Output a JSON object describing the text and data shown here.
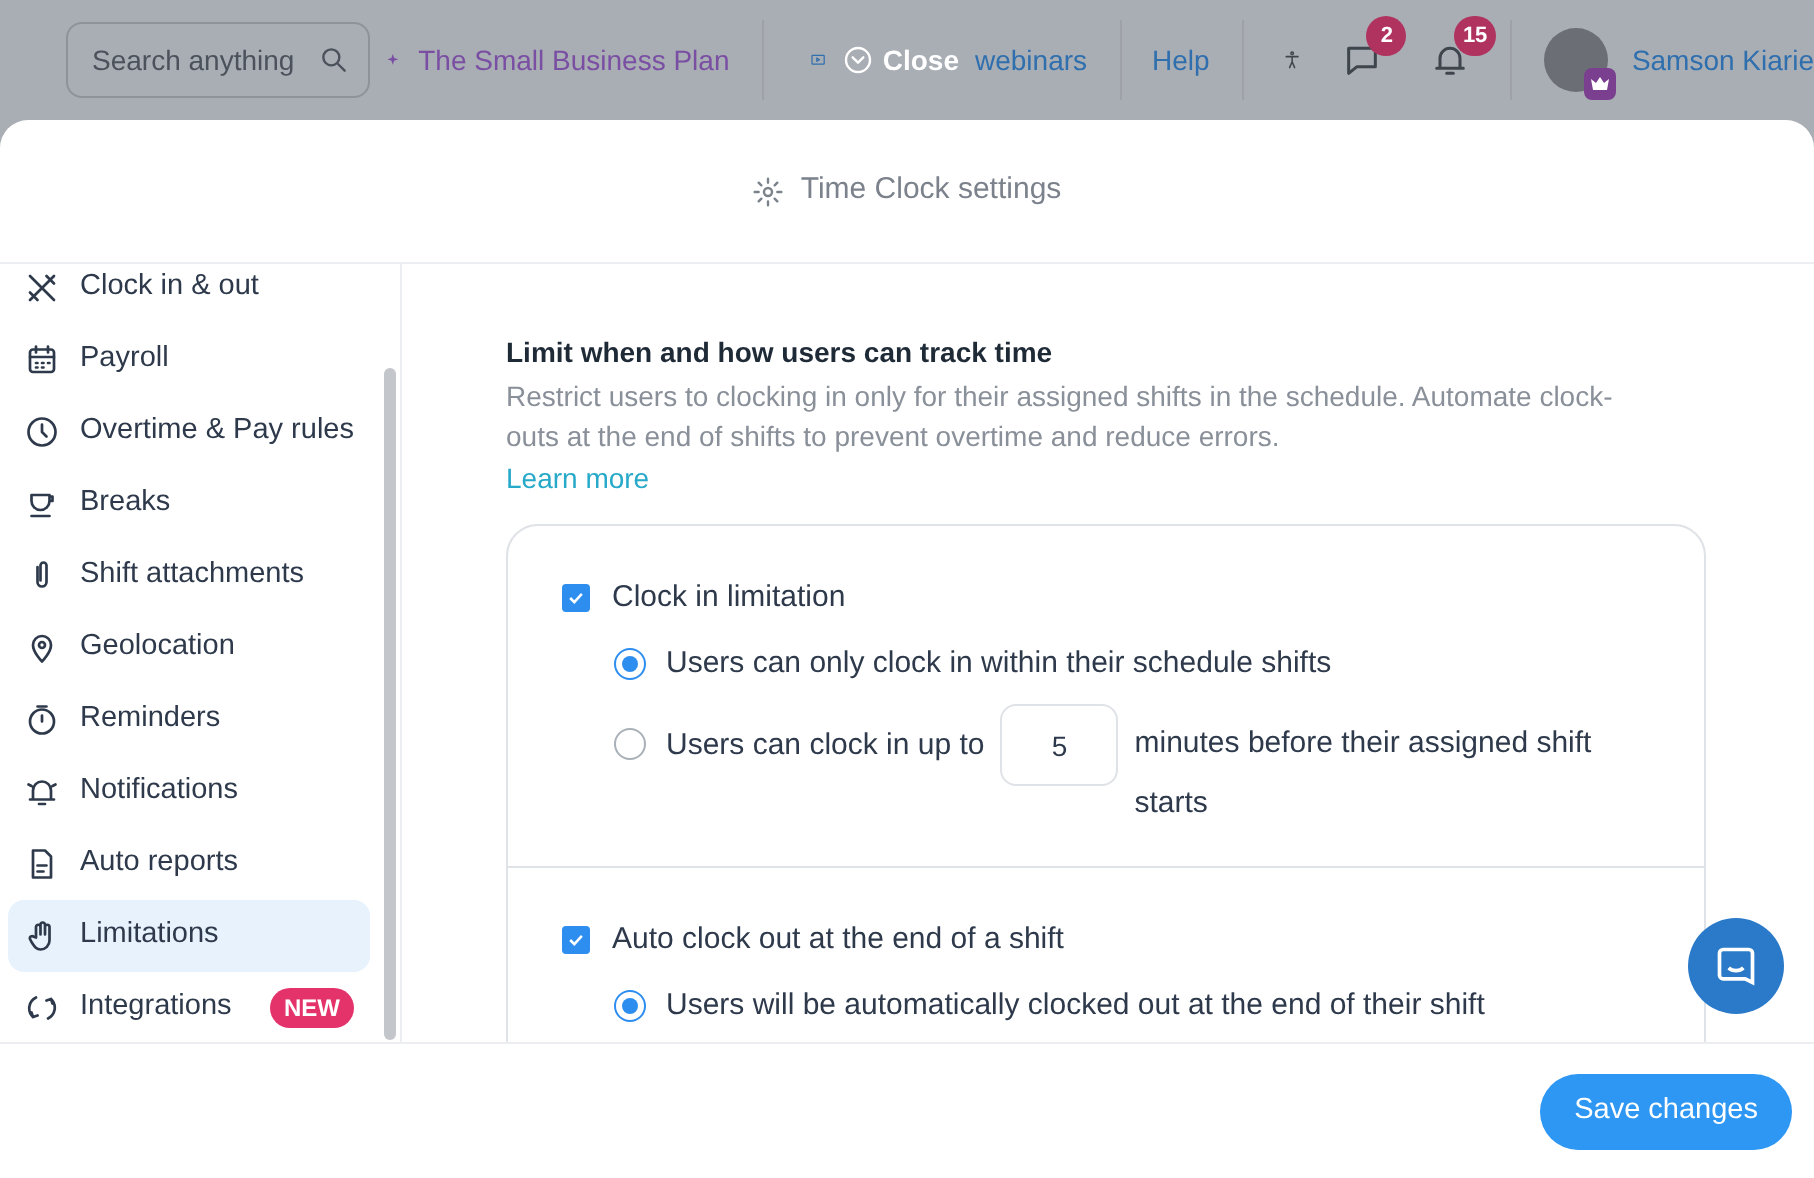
{
  "topbar": {
    "search": {
      "placeholder": "Search anything"
    },
    "plan_link": "The Small Business Plan",
    "webinars_link": "webinars",
    "help_link": "Help",
    "messages_count": "2",
    "notifications_count": "15",
    "user_name": "Samson Kiarie"
  },
  "close_button": "Close",
  "modal": {
    "title": "Time Clock settings"
  },
  "sidebar": {
    "items": [
      {
        "label": "Clock in & out",
        "selected": false
      },
      {
        "label": "Payroll",
        "selected": false
      },
      {
        "label": "Overtime & Pay rules",
        "selected": false
      },
      {
        "label": "Breaks",
        "selected": false
      },
      {
        "label": "Shift attachments",
        "selected": false
      },
      {
        "label": "Geolocation",
        "selected": false
      },
      {
        "label": "Reminders",
        "selected": false
      },
      {
        "label": "Notifications",
        "selected": false
      },
      {
        "label": "Auto reports",
        "selected": false
      },
      {
        "label": "Limitations",
        "selected": true
      },
      {
        "label": "Integrations",
        "selected": false,
        "badge": "NEW"
      }
    ]
  },
  "content": {
    "heading": "Limit when and how users can track time",
    "description": "Restrict users to clocking in only for their assigned shifts in the schedule. Automate clock-outs at the end of shifts to prevent overtime and reduce errors.",
    "learn_more": "Learn more",
    "sections": [
      {
        "label": "Clock in limitation",
        "checked": true,
        "options": [
          {
            "kind": "plain",
            "label": "Users can only clock in within their schedule shifts",
            "selected": true
          },
          {
            "kind": "minutes",
            "before": "Users can clock in up to",
            "value": "5",
            "after": "minutes before their assigned shift starts",
            "selected": false
          }
        ]
      },
      {
        "label": "Auto clock out at the end of a shift",
        "checked": true,
        "options": [
          {
            "kind": "plain",
            "label": "Users will be automatically clocked out at the end of their shift",
            "selected": true
          }
        ]
      }
    ]
  },
  "footer": {
    "save_button": "Save changes"
  }
}
